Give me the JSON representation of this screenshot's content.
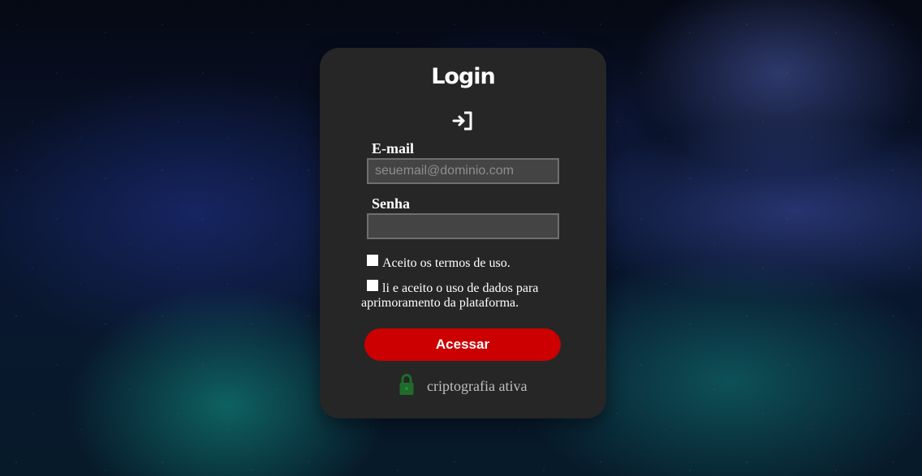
{
  "login": {
    "title": "Login",
    "email_label": "E-mail",
    "email_placeholder": "seuemail@dominio.com",
    "password_label": "Senha",
    "password_value": "",
    "terms_checkbox_label": "Aceito os termos de uso.",
    "data_usage_checkbox_line1": "li e aceito o uso de dados para",
    "data_usage_checkbox_line2": "aprimoramento da plataforma.",
    "submit_label": "Acessar",
    "security_text": "criptografia ativa"
  },
  "icons": {
    "login": "login-icon",
    "lock": "lock-icon"
  },
  "colors": {
    "card_background": "#262626",
    "button_background": "#cc0000",
    "lock_icon": "#1f6b2b",
    "input_background": "#444444"
  }
}
